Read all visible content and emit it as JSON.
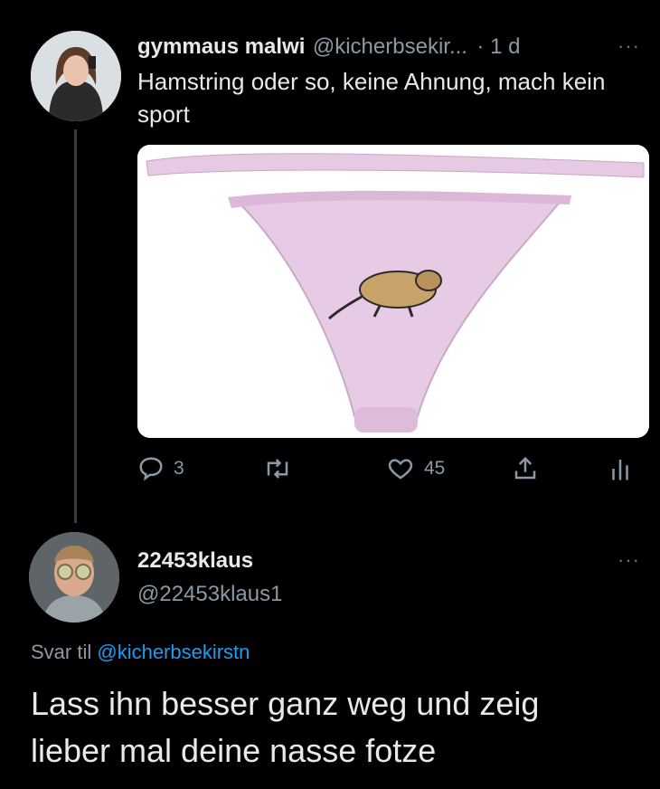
{
  "tweet": {
    "display_name": "gymmaus malwi",
    "handle": "@kicherbsekir...",
    "time": "· 1 d",
    "more": "···",
    "text": "Hamstring oder so, keine Ahnung, mach kein sport",
    "stats": {
      "replies": "3",
      "likes": "45"
    },
    "icons": [
      "reply-icon",
      "retweet-icon",
      "heart-icon",
      "share-icon",
      "analytics-icon"
    ]
  },
  "reply": {
    "display_name": "22453klaus",
    "handle": "@22453klaus1",
    "more": "···",
    "reply_to_prefix": "Svar til ",
    "reply_to_mention": "@kicherbsekirstn",
    "text": "Lass ihn besser ganz  weg und zeig lieber  mal deine nasse fotze"
  },
  "colors": {
    "background": "#000000",
    "text": "#e7e9ea",
    "muted": "#8b98a5",
    "link": "#1d9bf0",
    "panty": "#e6c9e3"
  }
}
